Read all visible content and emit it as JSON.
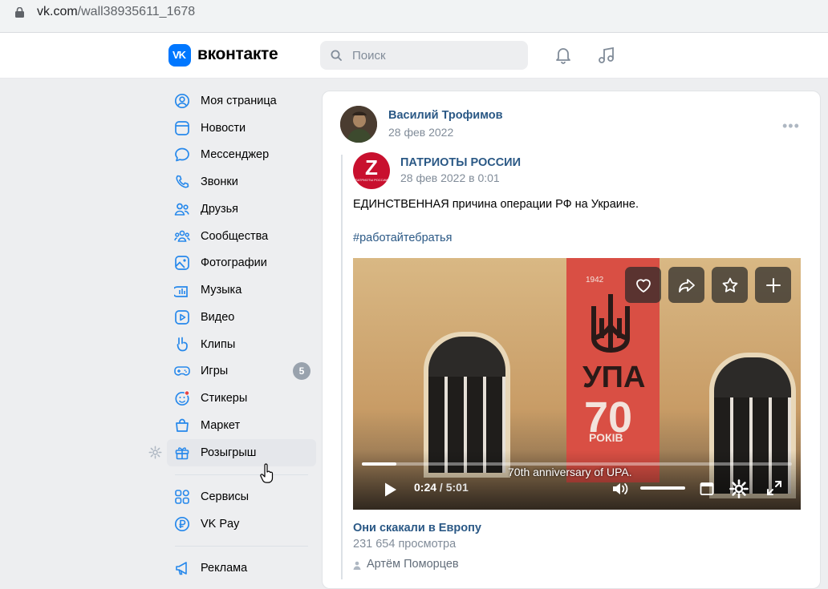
{
  "browser": {
    "url_host": "vk.com",
    "url_path": "/wall38935611_1678"
  },
  "header": {
    "logo_mark": "VK",
    "logo_text": "вконтакте",
    "search_placeholder": "Поиск"
  },
  "sidebar": {
    "items": [
      {
        "label": "Моя страница",
        "icon": "profile-icon"
      },
      {
        "label": "Новости",
        "icon": "news-icon"
      },
      {
        "label": "Мессенджер",
        "icon": "messenger-icon"
      },
      {
        "label": "Звонки",
        "icon": "phone-icon"
      },
      {
        "label": "Друзья",
        "icon": "friends-icon"
      },
      {
        "label": "Сообщества",
        "icon": "communities-icon"
      },
      {
        "label": "Фотографии",
        "icon": "photos-icon"
      },
      {
        "label": "Музыка",
        "icon": "music-icon"
      },
      {
        "label": "Видео",
        "icon": "video-icon"
      },
      {
        "label": "Клипы",
        "icon": "clips-icon"
      },
      {
        "label": "Игры",
        "icon": "games-icon",
        "badge": "5"
      },
      {
        "label": "Стикеры",
        "icon": "stickers-icon"
      },
      {
        "label": "Маркет",
        "icon": "market-icon"
      },
      {
        "label": "Розыгрыш",
        "icon": "gift-icon"
      },
      {
        "label": "Сервисы",
        "icon": "services-icon"
      },
      {
        "label": "VK Pay",
        "icon": "vkpay-icon"
      },
      {
        "label": "Реклама",
        "icon": "ads-icon"
      }
    ]
  },
  "post": {
    "author": "Василий Трофимов",
    "date": "28 фев 2022",
    "repost": {
      "group": "ПАТРИОТЫ РОССИИ",
      "group_avatar_letter": "Z",
      "group_avatar_sub": "ПАТРИОТЫ РОССИИ",
      "date": "28 фев 2022 в 0:01",
      "text": "ЕДИНСТВЕННАЯ причина операции РФ на Украине.",
      "hashtag": "#работайтебратья"
    },
    "video": {
      "banner_year": "1942",
      "banner_upa": "УПА",
      "banner_number": "70",
      "banner_rokiv": "РОКІВ",
      "caption": "70th anniversary of UPA.",
      "current_time": "0:24",
      "separator": " / ",
      "total_time": "5:01",
      "progress_fraction": 0.08,
      "title": "Они скакали в Европу",
      "views": "231 654 просмотра",
      "author": "Артём Поморцев"
    }
  },
  "colors": {
    "accent": "#0077ff",
    "link": "#2a5885",
    "muted": "#818c99",
    "background": "#edeef0"
  }
}
